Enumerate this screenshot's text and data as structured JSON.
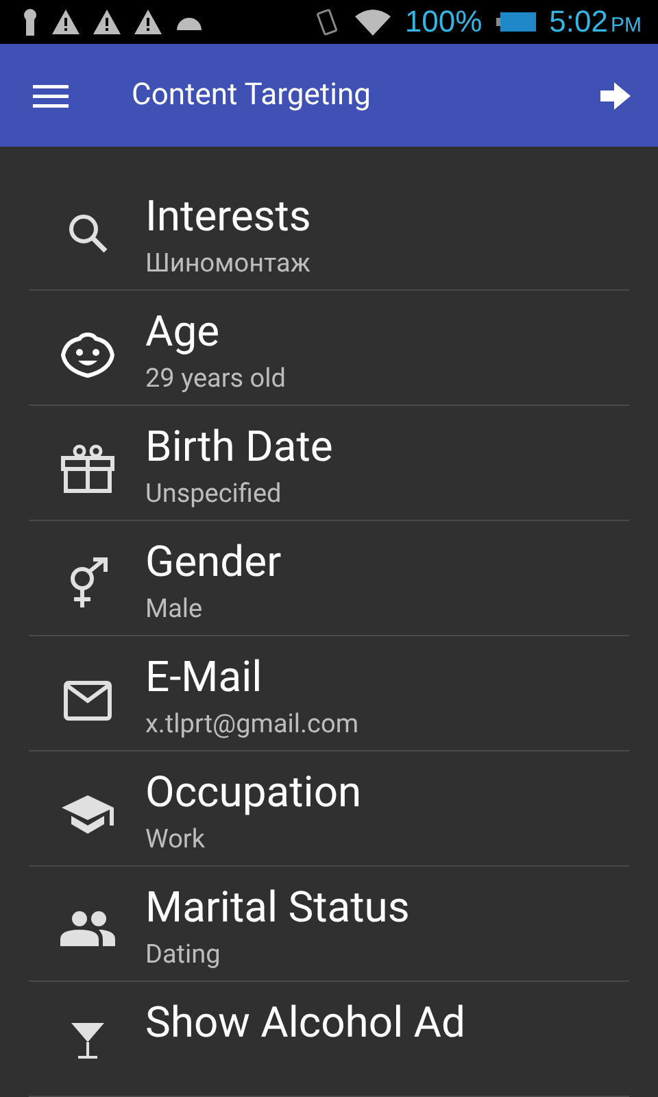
{
  "status_bar": {
    "battery": "100%",
    "time": "5:02",
    "ampm": "PM"
  },
  "app_bar": {
    "title": "Content Targeting"
  },
  "items": [
    {
      "title": "Interests",
      "value": "Шиномонтаж"
    },
    {
      "title": "Age",
      "value": "29 years old"
    },
    {
      "title": "Birth Date",
      "value": "Unspecified"
    },
    {
      "title": "Gender",
      "value": "Male"
    },
    {
      "title": "E-Mail",
      "value": "x.tlprt@gmail.com"
    },
    {
      "title": "Occupation",
      "value": "Work"
    },
    {
      "title": "Marital Status",
      "value": "Dating"
    },
    {
      "title": "Show Alcohol Ad"
    }
  ]
}
